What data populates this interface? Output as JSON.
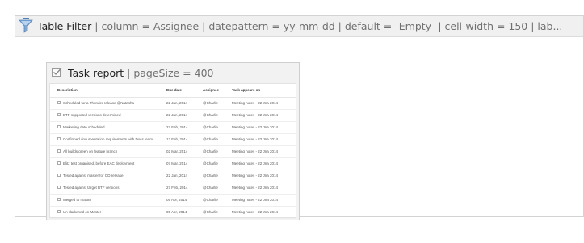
{
  "macro": {
    "title": "Table Filter",
    "params": "| column = Assignee | datepattern = yy-mm-dd | default = -Empty- | cell-width = 150 | lab..."
  },
  "inner": {
    "title": "Task report",
    "params": "| pageSize = 400"
  },
  "table": {
    "headers": {
      "description": "Description",
      "due_date": "Due date",
      "assignee": "Assignee",
      "appears_on": "Task appears on"
    },
    "rows": [
      {
        "description": "Scheduled for a Thunder release @Natasha",
        "due_date": "22 Jan, 2014",
        "assignee": "@Charlie",
        "appears_on": "Meeting notes - 22 Jna 2014"
      },
      {
        "description": "BTF supported versions determined",
        "due_date": "22 Jan, 2014",
        "assignee": "@Charlie",
        "appears_on": "Meeting notes - 22 Jna 2014"
      },
      {
        "description": "Marketing date scheduled",
        "due_date": "27 Feb, 2014",
        "assignee": "@Charlie",
        "appears_on": "Meeting notes - 22 Jna 2014"
      },
      {
        "description": "Confirmed documentation requirements with Docs team",
        "due_date": "13 Feb, 2014",
        "assignee": "@Charlie",
        "appears_on": "Meeting notes - 22 Jna 2014"
      },
      {
        "description": "All builds green on feature branch",
        "due_date": "02 Mar, 2014",
        "assignee": "@Charlie",
        "appears_on": "Meeting notes - 22 Jna 2014"
      },
      {
        "description": "Blitz test organised, before EAC deployment",
        "due_date": "07 Mar, 2014",
        "assignee": "@Charlie",
        "appears_on": "Meeting notes - 22 Jna 2014"
      },
      {
        "description": "Tested against master for OD release",
        "due_date": "22 Jan, 2014",
        "assignee": "@Charlie",
        "appears_on": "Meeting notes - 22 Jna 2014"
      },
      {
        "description": "Tested against target BTF versions",
        "due_date": "27 Feb, 2014",
        "assignee": "@Charlie",
        "appears_on": "Meeting notes - 22 Jna 2014"
      },
      {
        "description": "Merged to master",
        "due_date": "05 Apr, 2014",
        "assignee": "@Charlie",
        "appears_on": "Meeting notes - 22 Jna 2014"
      },
      {
        "description": "Un-darkened on Master",
        "due_date": "05 Apr, 2014",
        "assignee": "@Charlie",
        "appears_on": "Meeting notes - 22 Jna 2014"
      }
    ]
  },
  "icons": {
    "macro": "filter-icon",
    "inner": "checkbox-icon"
  },
  "colors": {
    "header_bg": "#f0f0f0",
    "inner_bg": "#f2f2f2",
    "filter_icon": "#7aa9d8"
  }
}
